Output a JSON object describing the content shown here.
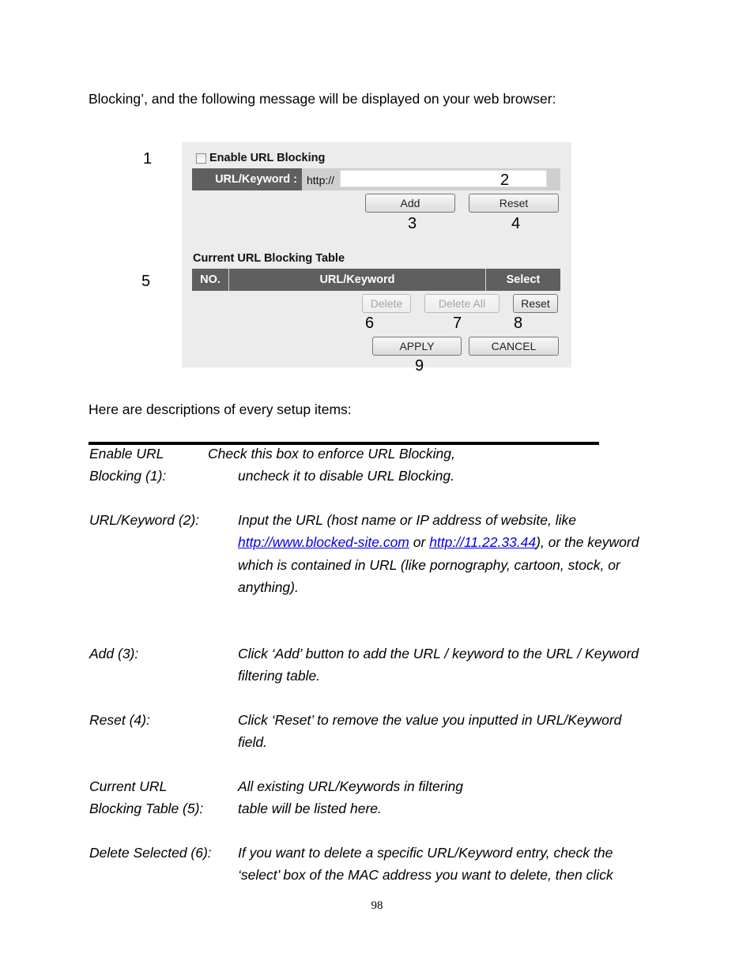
{
  "intro_text": "Blocking’, and the following message will be displayed on your web browser:",
  "screenshot": {
    "callouts": [
      "1",
      "2",
      "3",
      "4",
      "5",
      "6",
      "7",
      "8",
      "9"
    ],
    "enable_checkbox": {
      "label": "Enable URL Blocking",
      "checked": false
    },
    "url_field": {
      "label": "URL/Keyword :",
      "prefix": "http://",
      "value": ""
    },
    "buttons": {
      "add": "Add",
      "reset": "Reset",
      "delete": "Delete",
      "delete_all": "Delete All",
      "table_reset": "Reset",
      "apply": "APPLY",
      "cancel": "CANCEL"
    },
    "table": {
      "title": "Current URL Blocking Table",
      "columns": [
        "NO.",
        "URL/Keyword",
        "Select"
      ]
    }
  },
  "descriptions_heading": "Here are descriptions of every setup items:",
  "descriptions": [
    {
      "term1": "Enable URL",
      "term2": "Blocking (1):",
      "line1": "Check this box to enforce URL Blocking,",
      "line2": "uncheck it to disable URL Blocking."
    },
    {
      "term": "URL/Keyword (2):",
      "line1": "Input the URL (host name or IP address of website, like",
      "link1": "http://www.blocked-site.com",
      "mid": " or ",
      "link2": "http://11.22.33.44",
      "after": "), or the keyword",
      "line3": "which is contained in URL (like pornography, cartoon, stock, or",
      "line4": "anything)."
    },
    {
      "term": "Add (3):",
      "line1": "Click ‘Add’ button to add the URL / keyword to the URL / Keyword",
      "line2": "filtering table."
    },
    {
      "term": "Reset (4):",
      "line1": "Click ‘Reset’ to remove the value you inputted in URL/Keyword",
      "line2": "field."
    },
    {
      "term1": "Current URL",
      "term2": "Blocking Table (5):",
      "line1": "All existing URL/Keywords in filtering",
      "line2": "table will be listed here."
    },
    {
      "term": "Delete Selected (6):",
      "line1": "If you want to delete a specific URL/Keyword entry, check the",
      "line2": "‘select’ box of the MAC address you want to delete, then click"
    }
  ],
  "page_number": "98"
}
